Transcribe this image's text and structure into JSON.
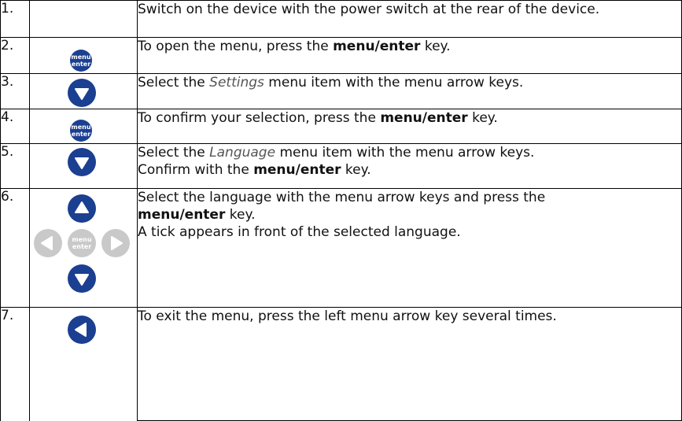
{
  "steps": [
    {
      "number": "1.",
      "icons": [],
      "lines": [
        [
          "Switch on the device with the power switch at the rear of the device."
        ]
      ]
    },
    {
      "number": "2.",
      "icons": [
        "menu-enter-key"
      ],
      "parts": [
        "To open the menu, press the ",
        "menu/enter",
        " key."
      ]
    },
    {
      "number": "3.",
      "icons": [
        "arrow-down-key"
      ],
      "parts": [
        "Select the ",
        "Settings",
        " menu item with the menu arrow keys."
      ]
    },
    {
      "number": "4.",
      "icons": [
        "menu-enter-key"
      ],
      "parts": [
        "To confirm your selection, press the ",
        "menu/enter",
        " key."
      ]
    },
    {
      "number": "5.",
      "icons": [
        "arrow-down-key"
      ],
      "line1": [
        "Select the ",
        "Language",
        " menu item with the menu arrow keys."
      ],
      "line2": [
        "Confirm with the ",
        "menu/enter",
        " key."
      ]
    },
    {
      "number": "6.",
      "icons": [
        "arrow-up-key",
        "arrow-left-key-grey",
        "menu-enter-key-grey",
        "arrow-right-key-grey",
        "arrow-down-key"
      ],
      "line1": [
        "Select the language with the menu arrow keys and press the"
      ],
      "line2": [
        "menu/enter",
        " key."
      ],
      "line3": [
        "A tick appears in front of the selected language."
      ]
    },
    {
      "number": "7.",
      "icons": [
        "arrow-left-key"
      ],
      "parts": [
        "To exit the menu, press the left menu arrow key several times."
      ]
    }
  ],
  "key_labels": {
    "menu": "menu",
    "enter": "enter"
  },
  "colors": {
    "key_blue": "#1b3f91",
    "key_grey": "#c9c9c9",
    "border": "#000000"
  }
}
